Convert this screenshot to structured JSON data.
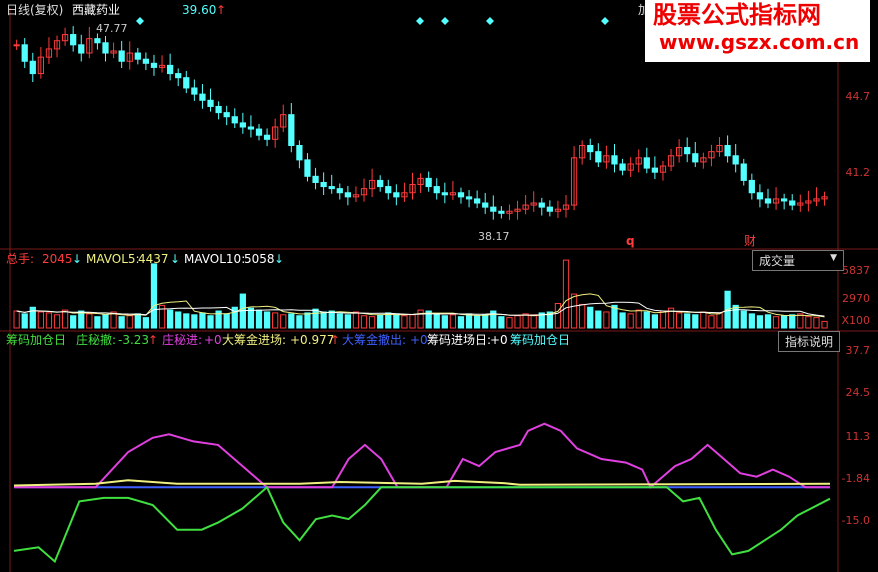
{
  "header": {
    "chart_mode": "日线(复权)",
    "stock_name": "西藏药业",
    "price": "39.60",
    "price_arrow": "↑",
    "right_cut": "加"
  },
  "watermark": {
    "line1": "股票公式指标网",
    "line2": "www.gszx.com.cn"
  },
  "price_axis": [
    "44.7",
    "41.2"
  ],
  "price_annotations": {
    "high": "47.77",
    "low": "38.17",
    "marker_q": "q",
    "marker_cai": "财"
  },
  "volume_legend": {
    "total_label": "总手:",
    "total_value": "2045",
    "mavol5_label": "MAVOL5:",
    "mavol5_value": "4437",
    "mavol10_label": "MAVOL10:",
    "mavol10_value": "5058",
    "arrow": "↓"
  },
  "volume_axis": [
    "5837",
    "2970",
    "X100"
  ],
  "volume_button": "成交量",
  "indicator_legend": {
    "name": "筹码加仓日",
    "l1_label": "庄秘撤:",
    "l1_value": "-3.23",
    "l1_arrow": "↑",
    "l2_label": "庄秘进:",
    "l2_value": "+0",
    "l3_label": "大筹金进场:",
    "l3_value": "+0.977",
    "l3_arrow": "↑",
    "l4_label": "大筹金撤出:",
    "l4_value": "+0",
    "l5_label": "筹码进场日:",
    "l5_value": "+0",
    "l6_label": "筹码加仓日"
  },
  "indicator_axis": [
    "37.7",
    "24.5",
    "11.3",
    "-1.84",
    "-15.0"
  ],
  "indicator_button": "指标说明",
  "colors": {
    "up": "#ff3b3b",
    "down": "#54ffff",
    "magenta": "#e040e0",
    "yellow": "#f0f080",
    "green": "#40e040",
    "blue": "#4060ff",
    "axis": "#c03030"
  },
  "chart_data": [
    {
      "type": "candlestick",
      "title": "",
      "ylim": [
        37.5,
        48.5
      ],
      "ticks": [
        44.7,
        41.2
      ],
      "annotations": [
        {
          "text": "47.77",
          "value": 47.77
        },
        {
          "text": "38.17",
          "value": 38.17
        }
      ],
      "ohlc_close": [
        47.0,
        46.2,
        45.6,
        46.4,
        46.8,
        47.2,
        47.5,
        47.0,
        46.6,
        47.3,
        47.1,
        46.6,
        46.7,
        46.2,
        46.6,
        46.3,
        46.1,
        45.9,
        46.0,
        45.6,
        45.4,
        44.9,
        44.6,
        44.3,
        44.0,
        43.7,
        43.5,
        43.2,
        43.0,
        42.9,
        42.6,
        42.4,
        43.0,
        43.6,
        42.1,
        41.4,
        40.6,
        40.3,
        40.1,
        40.0,
        39.8,
        39.6,
        39.7,
        40.0,
        40.4,
        40.1,
        39.8,
        39.6,
        39.8,
        40.2,
        40.5,
        40.1,
        39.8,
        39.7,
        39.8,
        39.6,
        39.5,
        39.3,
        39.1,
        38.9,
        38.8,
        38.9,
        39.0,
        39.2,
        39.3,
        39.1,
        38.9,
        39.0,
        39.2,
        41.5,
        42.1,
        41.8,
        41.3,
        41.6,
        41.2,
        40.9,
        41.2,
        41.5,
        41.0,
        40.8,
        41.1,
        41.6,
        42.0,
        41.7,
        41.3,
        41.5,
        41.8,
        42.1,
        41.6,
        41.2,
        40.4,
        39.8,
        39.5,
        39.3,
        39.5,
        39.4,
        39.2,
        39.3,
        39.4,
        39.5,
        39.6
      ]
    },
    {
      "type": "bar",
      "title": "成交量",
      "ylim": [
        0,
        7000
      ],
      "ticks": [
        5837,
        2970
      ],
      "values": [
        1800,
        1500,
        2200,
        1700,
        1600,
        1400,
        1900,
        1300,
        1800,
        1500,
        1200,
        1400,
        1700,
        1200,
        1300,
        1500,
        1100,
        6800,
        2400,
        1900,
        1700,
        1500,
        1400,
        1600,
        1300,
        1800,
        1500,
        2200,
        3600,
        2100,
        1900,
        1700,
        1600,
        1400,
        1500,
        1300,
        1600,
        2000,
        1700,
        1800,
        1500,
        1400,
        1700,
        1300,
        1200,
        1400,
        1600,
        1500,
        1300,
        1400,
        1900,
        1800,
        1500,
        1300,
        1400,
        1200,
        1500,
        1300,
        1400,
        1800,
        1200,
        1100,
        1300,
        1500,
        1400,
        1600,
        1700,
        2600,
        7200,
        3600,
        2500,
        2200,
        1800,
        1700,
        2400,
        1600,
        1500,
        1900,
        1700,
        1400,
        1800,
        2100,
        1600,
        1500,
        1400,
        1700,
        1300,
        1600,
        3900,
        2400,
        1800,
        1500,
        1300,
        1400,
        1200,
        1300,
        1400,
        1500,
        1200,
        1100,
        700
      ]
    },
    {
      "type": "line",
      "title": "筹码加仓日",
      "ylim": [
        -22,
        40
      ],
      "ticks": [
        37.7,
        24.5,
        11.3,
        -1.84,
        -15.0
      ],
      "series": [
        {
          "name": "庄秘进",
          "color": "#e040e0",
          "points": [
            [
              0,
              0
            ],
            [
              0.1,
              0
            ],
            [
              0.14,
              10
            ],
            [
              0.17,
              14
            ],
            [
              0.19,
              15
            ],
            [
              0.22,
              13
            ],
            [
              0.25,
              12
            ],
            [
              0.28,
              6
            ],
            [
              0.31,
              0
            ],
            [
              0.39,
              0
            ],
            [
              0.41,
              8
            ],
            [
              0.43,
              12
            ],
            [
              0.45,
              8
            ],
            [
              0.47,
              0
            ],
            [
              0.53,
              0
            ],
            [
              0.55,
              8
            ],
            [
              0.57,
              6
            ],
            [
              0.59,
              10
            ],
            [
              0.62,
              12
            ],
            [
              0.63,
              16
            ],
            [
              0.65,
              18
            ],
            [
              0.67,
              16
            ],
            [
              0.69,
              11
            ],
            [
              0.72,
              8
            ],
            [
              0.75,
              7
            ],
            [
              0.77,
              5
            ],
            [
              0.78,
              0
            ],
            [
              0.81,
              6
            ],
            [
              0.83,
              8
            ],
            [
              0.85,
              12
            ],
            [
              0.87,
              8
            ],
            [
              0.89,
              4
            ],
            [
              0.91,
              3
            ],
            [
              0.93,
              5
            ],
            [
              0.95,
              3
            ],
            [
              0.97,
              0
            ],
            [
              1.0,
              0
            ]
          ]
        },
        {
          "name": "大筹金进场",
          "color": "#f0f080",
          "points": [
            [
              0,
              0.5
            ],
            [
              0.1,
              1
            ],
            [
              0.14,
              2
            ],
            [
              0.2,
              1
            ],
            [
              0.35,
              1
            ],
            [
              0.4,
              1.5
            ],
            [
              0.5,
              1
            ],
            [
              0.54,
              1.8
            ],
            [
              0.6,
              1.2
            ],
            [
              0.62,
              0.7
            ],
            [
              1.0,
              0.98
            ]
          ]
        },
        {
          "name": "庄秘撤",
          "color": "#40e040",
          "points": [
            [
              0,
              -18
            ],
            [
              0.03,
              -17
            ],
            [
              0.05,
              -21
            ],
            [
              0.08,
              -4
            ],
            [
              0.11,
              -3
            ],
            [
              0.14,
              -3
            ],
            [
              0.17,
              -5
            ],
            [
              0.2,
              -12
            ],
            [
              0.23,
              -12
            ],
            [
              0.25,
              -10
            ],
            [
              0.28,
              -6
            ],
            [
              0.31,
              0
            ],
            [
              0.33,
              -10
            ],
            [
              0.35,
              -15
            ],
            [
              0.37,
              -9
            ],
            [
              0.39,
              -8
            ],
            [
              0.41,
              -9
            ],
            [
              0.43,
              -5
            ],
            [
              0.45,
              0
            ],
            [
              0.8,
              0
            ],
            [
              0.82,
              -4
            ],
            [
              0.84,
              -3
            ],
            [
              0.86,
              -12
            ],
            [
              0.88,
              -19
            ],
            [
              0.9,
              -18
            ],
            [
              0.92,
              -15
            ],
            [
              0.94,
              -12
            ],
            [
              0.96,
              -8
            ],
            [
              1.0,
              -3.23
            ]
          ]
        }
      ]
    }
  ]
}
